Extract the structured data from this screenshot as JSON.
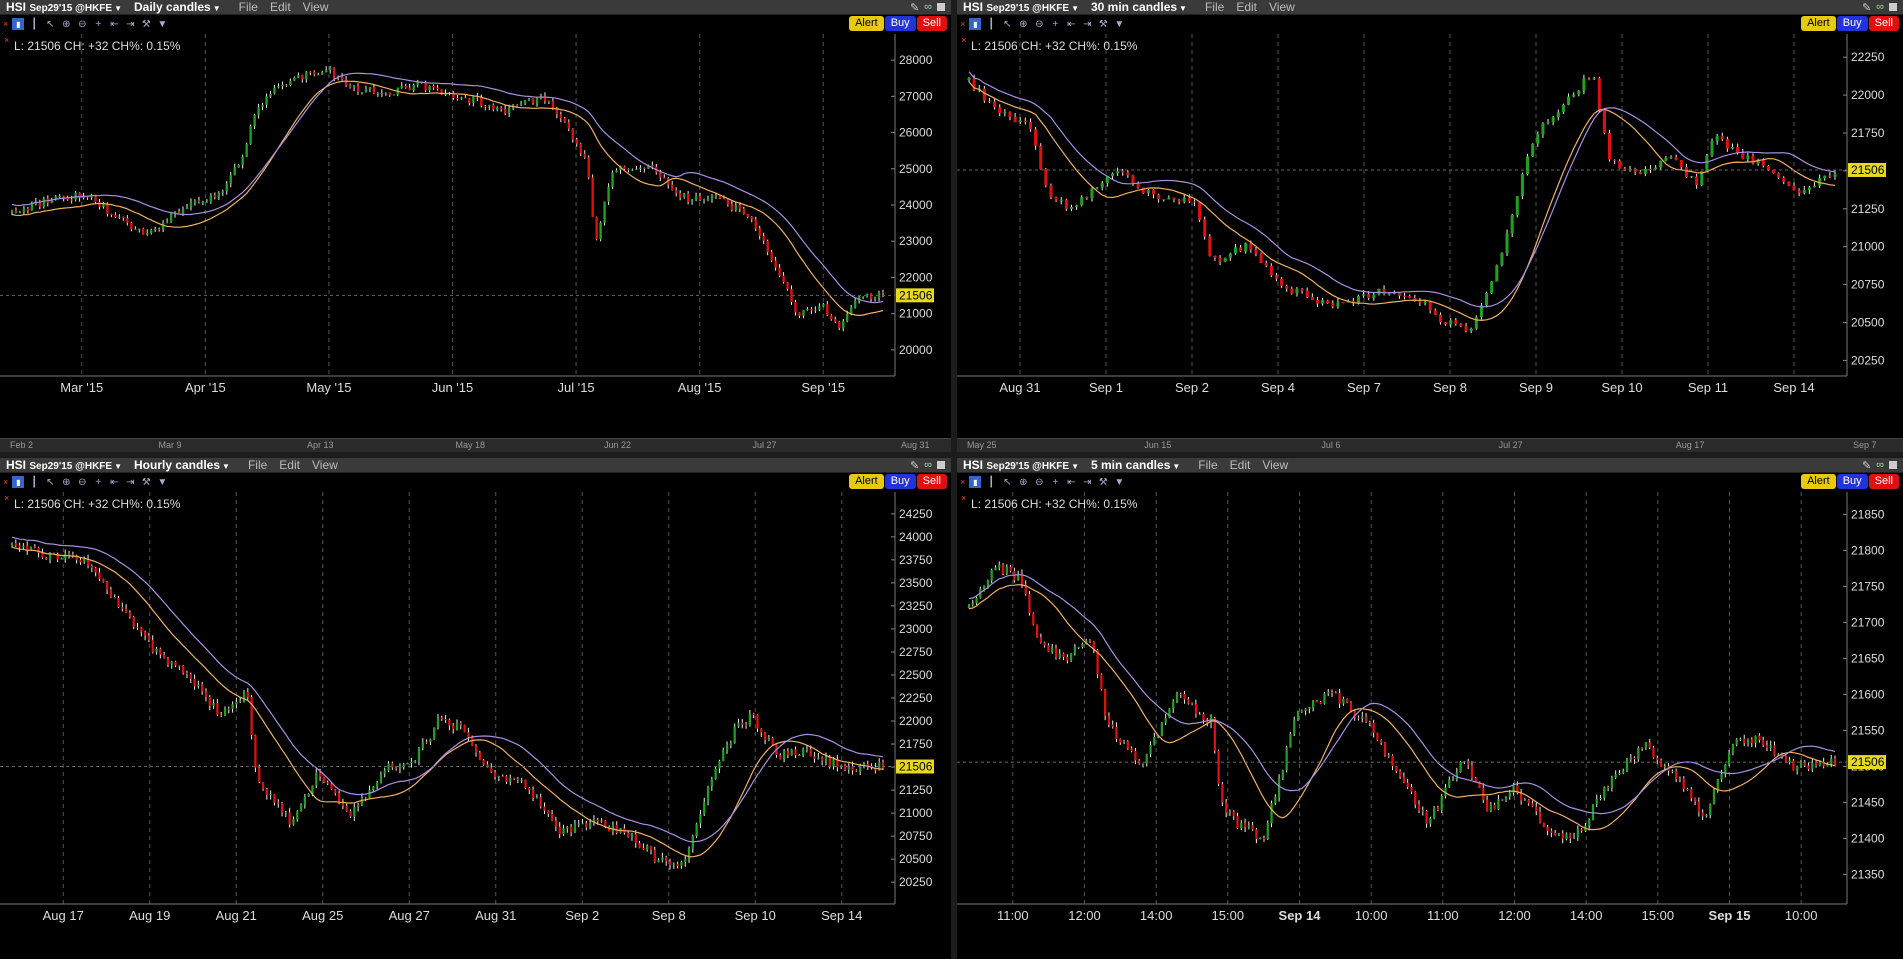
{
  "panels": [
    {
      "id": "daily",
      "symbol": "HSI",
      "contract": "Sep29'15 @HKFE",
      "timeframe": "Daily candles",
      "menus": [
        "File",
        "Edit",
        "View"
      ],
      "buttons": {
        "alert": "Alert",
        "buy": "Buy",
        "sell": "Sell"
      },
      "info": "L: 21506  CH: +32   CH%: 0.15%",
      "price_tag": "21506",
      "y_ticks": [
        "28000",
        "27000",
        "26000",
        "25000",
        "24000",
        "23000",
        "22000",
        "21000",
        "20000"
      ],
      "x_ticks": [
        "Mar '15",
        "Apr '15",
        "May '15",
        "Jun '15",
        "Jul '15",
        "Aug '15",
        "Sep '15"
      ],
      "scroll_labels": [
        "Feb 2",
        "Mar 9",
        "Apr 13",
        "May 18",
        "Jun 22",
        "Jul 27",
        "Aug 31"
      ]
    },
    {
      "id": "min30",
      "symbol": "HSI",
      "contract": "Sep29'15 @HKFE",
      "timeframe": "30 min candles",
      "menus": [
        "File",
        "Edit",
        "View"
      ],
      "buttons": {
        "alert": "Alert",
        "buy": "Buy",
        "sell": "Sell"
      },
      "info": "L: 21506  CH: +32   CH%: 0.15%",
      "price_tag": "21506",
      "y_ticks": [
        "22250",
        "22000",
        "21750",
        "21500",
        "21250",
        "21000",
        "20750",
        "20500",
        "20250"
      ],
      "x_ticks": [
        "Aug 31",
        "Sep 1",
        "Sep 2",
        "Sep 4",
        "Sep 7",
        "Sep 8",
        "Sep 9",
        "Sep 10",
        "Sep 11",
        "Sep 14"
      ],
      "scroll_labels": [
        "May 25",
        "Jun 15",
        "Jul 6",
        "Jul 27",
        "Aug 17",
        "Sep 7"
      ]
    },
    {
      "id": "hourly",
      "symbol": "HSI",
      "contract": "Sep29'15 @HKFE",
      "timeframe": "Hourly candles",
      "menus": [
        "File",
        "Edit",
        "View"
      ],
      "buttons": {
        "alert": "Alert",
        "buy": "Buy",
        "sell": "Sell"
      },
      "info": "L: 21506  CH: +32   CH%: 0.15%",
      "price_tag": "21506",
      "y_ticks": [
        "24250",
        "24000",
        "23750",
        "23500",
        "23250",
        "23000",
        "22750",
        "22500",
        "22250",
        "22000",
        "21750",
        "21500",
        "21250",
        "21000",
        "20750",
        "20500",
        "20250"
      ],
      "x_ticks": [
        "Aug 17",
        "Aug 19",
        "Aug 21",
        "Aug 25",
        "Aug 27",
        "Aug 31",
        "Sep 2",
        "Sep 8",
        "Sep 10",
        "Sep 14"
      ],
      "scroll_labels": []
    },
    {
      "id": "min5",
      "symbol": "HSI",
      "contract": "Sep29'15 @HKFE",
      "timeframe": "5 min candles",
      "menus": [
        "File",
        "Edit",
        "View"
      ],
      "buttons": {
        "alert": "Alert",
        "buy": "Buy",
        "sell": "Sell"
      },
      "info": "L: 21506  CH: +32   CH%: 0.15%",
      "price_tag": "21506",
      "y_ticks": [
        "21850",
        "21800",
        "21750",
        "21700",
        "21650",
        "21600",
        "21550",
        "21500",
        "21450",
        "21400",
        "21350"
      ],
      "x_ticks": [
        "11:00",
        "12:00",
        "14:00",
        "15:00",
        "Sep 14",
        "10:00",
        "11:00",
        "12:00",
        "14:00",
        "15:00",
        "Sep 15",
        "10:00"
      ],
      "scroll_labels": []
    }
  ],
  "colors": {
    "up": "#1fa01f",
    "down": "#e01010",
    "ma_fast": "#f0b060",
    "ma_slow": "#a890e0",
    "grid": "#555555",
    "price_tag_bg": "#e7d820"
  },
  "chart_data": [
    {
      "type": "candlestick",
      "title": "HSI Sep29'15 @HKFE Daily candles",
      "ylim": [
        19500,
        28500
      ],
      "close_path": [
        [
          0,
          23800
        ],
        [
          0.05,
          24200
        ],
        [
          0.09,
          24300
        ],
        [
          0.12,
          23600
        ],
        [
          0.16,
          23200
        ],
        [
          0.2,
          24000
        ],
        [
          0.24,
          24300
        ],
        [
          0.26,
          25100
        ],
        [
          0.28,
          26500
        ],
        [
          0.3,
          27200
        ],
        [
          0.33,
          27500
        ],
        [
          0.36,
          27800
        ],
        [
          0.39,
          27200
        ],
        [
          0.43,
          27100
        ],
        [
          0.47,
          27300
        ],
        [
          0.5,
          27100
        ],
        [
          0.53,
          26900
        ],
        [
          0.57,
          26600
        ],
        [
          0.61,
          27000
        ],
        [
          0.64,
          26000
        ],
        [
          0.66,
          25200
        ],
        [
          0.67,
          23000
        ],
        [
          0.69,
          25000
        ],
        [
          0.73,
          25100
        ],
        [
          0.77,
          24200
        ],
        [
          0.81,
          24200
        ],
        [
          0.85,
          23600
        ],
        [
          0.88,
          22200
        ],
        [
          0.9,
          21000
        ],
        [
          0.93,
          21300
        ],
        [
          0.95,
          20500
        ],
        [
          0.97,
          21500
        ],
        [
          1,
          21506
        ]
      ]
    },
    {
      "type": "candlestick",
      "title": "HSI Sep29'15 @HKFE 30 min candles",
      "ylim": [
        20200,
        22350
      ],
      "close_path": [
        [
          0,
          22100
        ],
        [
          0.03,
          21900
        ],
        [
          0.07,
          21800
        ],
        [
          0.09,
          21350
        ],
        [
          0.12,
          21250
        ],
        [
          0.17,
          21500
        ],
        [
          0.22,
          21300
        ],
        [
          0.26,
          21300
        ],
        [
          0.28,
          20900
        ],
        [
          0.32,
          21000
        ],
        [
          0.36,
          20750
        ],
        [
          0.42,
          20600
        ],
        [
          0.47,
          20700
        ],
        [
          0.52,
          20650
        ],
        [
          0.55,
          20500
        ],
        [
          0.58,
          20450
        ],
        [
          0.6,
          20700
        ],
        [
          0.62,
          21050
        ],
        [
          0.64,
          21500
        ],
        [
          0.66,
          21800
        ],
        [
          0.69,
          21950
        ],
        [
          0.72,
          22150
        ],
        [
          0.74,
          21550
        ],
        [
          0.78,
          21500
        ],
        [
          0.81,
          21600
        ],
        [
          0.84,
          21400
        ],
        [
          0.86,
          21750
        ],
        [
          0.89,
          21600
        ],
        [
          0.93,
          21500
        ],
        [
          0.96,
          21350
        ],
        [
          1,
          21506
        ]
      ]
    },
    {
      "type": "candlestick",
      "title": "HSI Sep29'15 @HKFE Hourly candles",
      "ylim": [
        20100,
        24400
      ],
      "close_path": [
        [
          0,
          23900
        ],
        [
          0.04,
          23800
        ],
        [
          0.08,
          23750
        ],
        [
          0.12,
          23300
        ],
        [
          0.16,
          22800
        ],
        [
          0.2,
          22500
        ],
        [
          0.24,
          22050
        ],
        [
          0.27,
          22300
        ],
        [
          0.28,
          21400
        ],
        [
          0.32,
          20900
        ],
        [
          0.35,
          21400
        ],
        [
          0.39,
          21000
        ],
        [
          0.43,
          21500
        ],
        [
          0.46,
          21550
        ],
        [
          0.49,
          22000
        ],
        [
          0.52,
          21900
        ],
        [
          0.55,
          21400
        ],
        [
          0.59,
          21300
        ],
        [
          0.63,
          20800
        ],
        [
          0.67,
          20900
        ],
        [
          0.71,
          20750
        ],
        [
          0.74,
          20500
        ],
        [
          0.77,
          20450
        ],
        [
          0.8,
          21300
        ],
        [
          0.83,
          21900
        ],
        [
          0.85,
          22050
        ],
        [
          0.88,
          21600
        ],
        [
          0.91,
          21700
        ],
        [
          0.95,
          21500
        ],
        [
          1,
          21506
        ]
      ]
    },
    {
      "type": "candlestick",
      "title": "HSI Sep29'15 @HKFE 5 min candles",
      "ylim": [
        21320,
        21870
      ],
      "close_path": [
        [
          0,
          21720
        ],
        [
          0.03,
          21780
        ],
        [
          0.06,
          21760
        ],
        [
          0.08,
          21670
        ],
        [
          0.11,
          21650
        ],
        [
          0.14,
          21680
        ],
        [
          0.16,
          21560
        ],
        [
          0.2,
          21500
        ],
        [
          0.24,
          21600
        ],
        [
          0.28,
          21560
        ],
        [
          0.29,
          21450
        ],
        [
          0.31,
          21420
        ],
        [
          0.34,
          21400
        ],
        [
          0.38,
          21580
        ],
        [
          0.42,
          21600
        ],
        [
          0.46,
          21560
        ],
        [
          0.5,
          21480
        ],
        [
          0.53,
          21420
        ],
        [
          0.57,
          21510
        ],
        [
          0.6,
          21440
        ],
        [
          0.63,
          21470
        ],
        [
          0.67,
          21410
        ],
        [
          0.7,
          21400
        ],
        [
          0.74,
          21480
        ],
        [
          0.78,
          21530
        ],
        [
          0.82,
          21480
        ],
        [
          0.85,
          21430
        ],
        [
          0.88,
          21530
        ],
        [
          0.91,
          21540
        ],
        [
          0.95,
          21500
        ],
        [
          1,
          21506
        ]
      ]
    }
  ]
}
